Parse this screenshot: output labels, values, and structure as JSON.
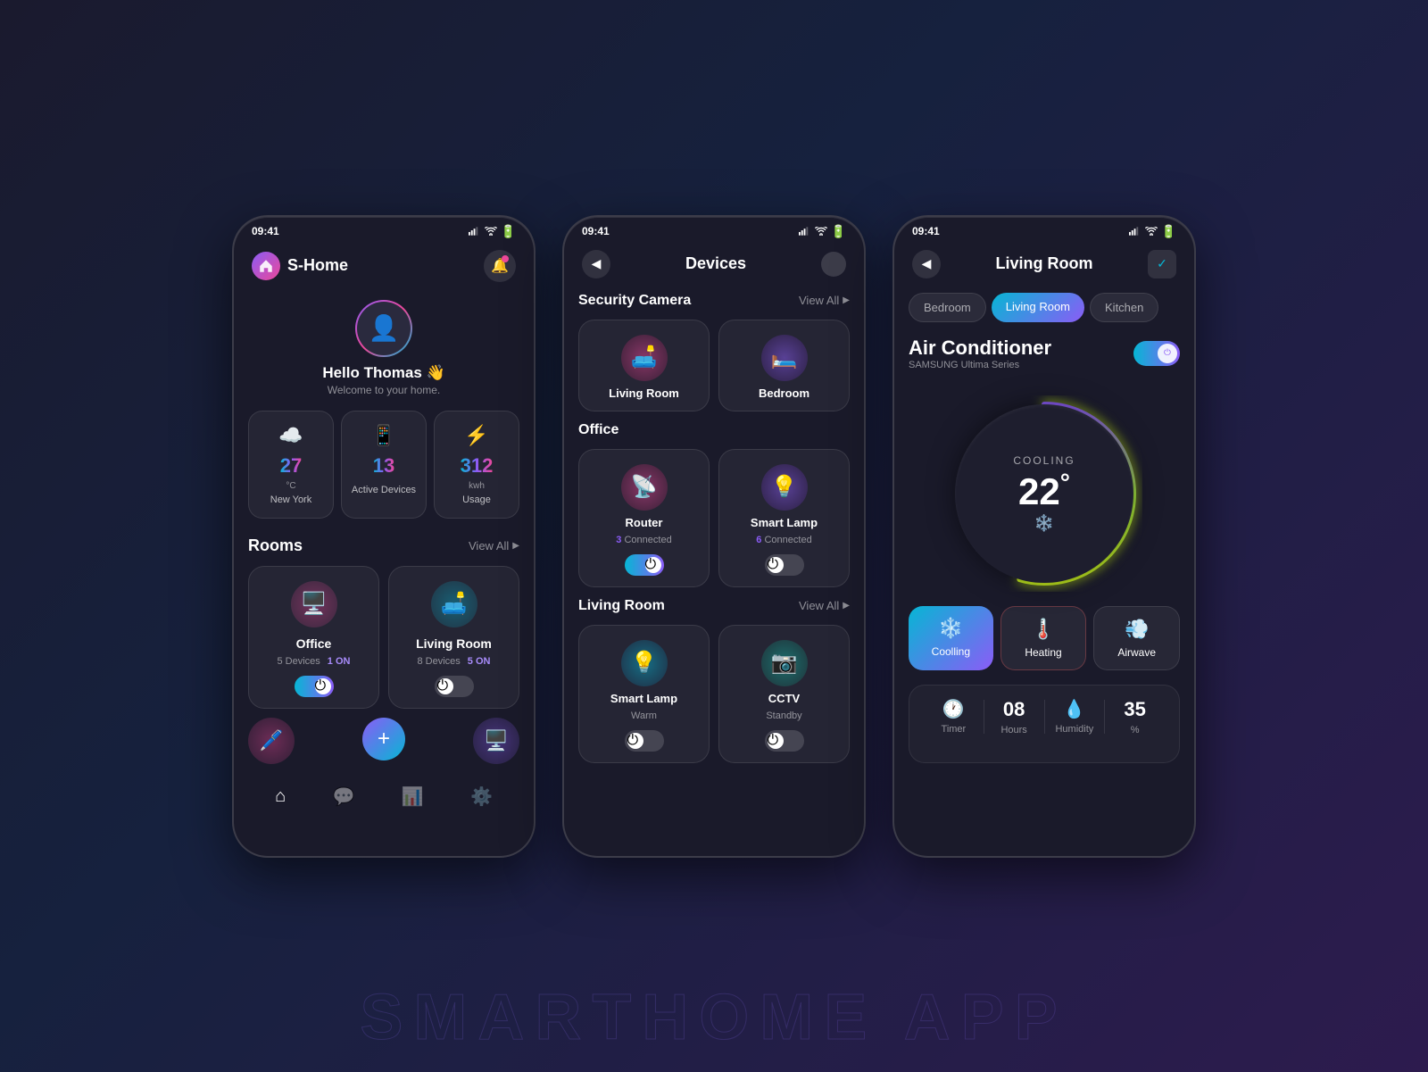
{
  "app": {
    "name": "S-Home",
    "status_time": "09:41"
  },
  "phone1": {
    "header": {
      "title": "S-Home",
      "back_label": "◀"
    },
    "user": {
      "greeting": "Hello Thomas 👋",
      "subtitle": "Welcome to your home."
    },
    "stats": [
      {
        "icon": "☁️",
        "value": "27",
        "unit": "°C",
        "label": "New York"
      },
      {
        "icon": "📱",
        "value": "13",
        "unit": "",
        "label": "Active\nDevices"
      },
      {
        "icon": "⚡",
        "value": "312",
        "unit": "kwh",
        "label": "Usage"
      }
    ],
    "rooms_title": "Rooms",
    "view_all": "View All",
    "rooms": [
      {
        "name": "Office",
        "icon": "🖥️",
        "devices": "5 Devices",
        "on": "1 ON",
        "active": true
      },
      {
        "name": "Living Room",
        "icon": "🛋️",
        "devices": "8 Devices",
        "on": "5 ON",
        "active": false
      }
    ],
    "nav": [
      {
        "icon": "⌂",
        "label": "Home",
        "active": true
      },
      {
        "icon": "💬",
        "label": "",
        "active": false
      },
      {
        "icon": "+",
        "label": "",
        "active": false,
        "is_add": true
      },
      {
        "icon": "📊",
        "label": "",
        "active": false
      },
      {
        "icon": "⚙️",
        "label": "",
        "active": false
      }
    ]
  },
  "phone2": {
    "header": {
      "title": "Devices"
    },
    "sections": [
      {
        "title": "Security Camera",
        "view_all": "View All",
        "devices": [
          {
            "name": "Living Room",
            "icon": "🛋️",
            "type": "camera",
            "color": "pink"
          },
          {
            "name": "Bedroom",
            "icon": "🛏️",
            "type": "camera",
            "color": "purple"
          }
        ]
      },
      {
        "title": "Office",
        "devices": [
          {
            "name": "Router",
            "count": "3",
            "status": "Connected",
            "icon": "📡",
            "color": "pink",
            "active": true
          },
          {
            "name": "Smart Lamp",
            "count": "6",
            "status": "Connected",
            "icon": "💡",
            "color": "purple",
            "active": false
          }
        ]
      },
      {
        "title": "Living Room",
        "view_all": "View All",
        "devices": [
          {
            "name": "Smart Lamp",
            "status": "Warm",
            "icon": "💡",
            "color": "cyan",
            "active": false
          },
          {
            "name": "CCTV",
            "status": "Standby",
            "icon": "📷",
            "color": "teal",
            "active": false
          }
        ]
      }
    ]
  },
  "phone3": {
    "header": {
      "title": "Living Room"
    },
    "tabs": [
      "Bedroom",
      "Living Room",
      "Kitchen"
    ],
    "active_tab": "Living Room",
    "ac": {
      "title": "Air Conditioner",
      "brand": "SAMSUNG Ultima Series",
      "mode": "COOLING",
      "temp": "22",
      "degree": "°"
    },
    "modes": [
      {
        "icon": "❄️",
        "label": "Coolling",
        "active": true
      },
      {
        "icon": "🌡️",
        "label": "Heating",
        "active": false
      },
      {
        "icon": "💨",
        "label": "Airwave",
        "active": false
      }
    ],
    "info": [
      {
        "icon": "🕐",
        "label": "Timer",
        "value": ""
      },
      {
        "icon": "⏰",
        "label": "Hours",
        "value": "08"
      },
      {
        "icon": "💧",
        "label": "Humidity",
        "value": ""
      },
      {
        "icon": "💧",
        "label": "%",
        "value": "35"
      }
    ],
    "timer_label": "Timer",
    "hours_label": "Hours",
    "hours_value": "08",
    "humidity_label": "Humidity",
    "humidity_value": "35",
    "humidity_unit": "%"
  }
}
